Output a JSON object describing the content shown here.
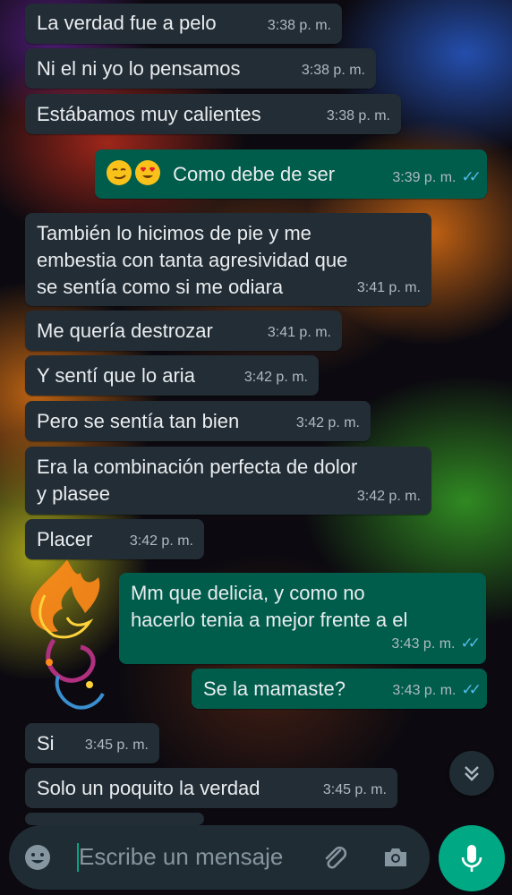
{
  "messages": [
    {
      "text": "La verdad fue a pelo",
      "time": "3:38 p. m."
    },
    {
      "text": "Ni el ni yo lo pensamos",
      "time": "3:38 p. m."
    },
    {
      "text": "Estábamos muy calientes",
      "time": "3:38 p. m."
    },
    {
      "text": "Como debe de ser",
      "time": "3:39 p. m.",
      "emoji": [
        "smirking-face-icon",
        "heart-eyes-face-icon"
      ]
    },
    {
      "text_line1": "También lo hicimos de pie y me",
      "text_line2": "embestia con tanta agresividad que",
      "text_line3": "se sentía como si me odiara",
      "time": "3:41 p. m."
    },
    {
      "text": "Me quería destrozar",
      "time": "3:41 p. m."
    },
    {
      "text": "Y sentí que lo aria",
      "time": "3:42 p. m."
    },
    {
      "text": "Pero se sentía tan bien",
      "time": "3:42 p. m."
    },
    {
      "text_line1": "Era la combinación perfecta de dolor",
      "text_line2": "y plasee",
      "time": "3:42 p. m."
    },
    {
      "text": "Placer",
      "time": "3:42 p. m."
    },
    {
      "text_line1": "Mm que delicia, y como no",
      "text_line2": "hacerlo tenia a mejor frente a el",
      "time": "3:43 p. m."
    },
    {
      "text": "Se la mamaste?",
      "time": "3:43 p. m."
    },
    {
      "text": "Si",
      "time": "3:45 p. m."
    },
    {
      "text": "Solo un poquito la verdad",
      "time": "3:45 p. m."
    }
  ],
  "composer": {
    "placeholder": "Escribe un mensaje"
  },
  "colors": {
    "incoming_bubble": "#232d36",
    "outgoing_bubble": "#005c4b",
    "read_ticks": "#53bdeb",
    "accent": "#00a884"
  }
}
